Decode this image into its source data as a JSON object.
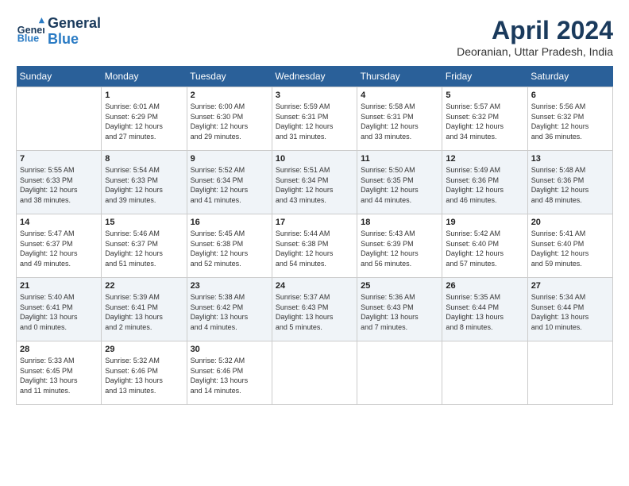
{
  "header": {
    "logo_line1": "General",
    "logo_line2": "Blue",
    "month": "April 2024",
    "location": "Deoranian, Uttar Pradesh, India"
  },
  "weekdays": [
    "Sunday",
    "Monday",
    "Tuesday",
    "Wednesday",
    "Thursday",
    "Friday",
    "Saturday"
  ],
  "weeks": [
    [
      {
        "day": "",
        "info": ""
      },
      {
        "day": "1",
        "info": "Sunrise: 6:01 AM\nSunset: 6:29 PM\nDaylight: 12 hours\nand 27 minutes."
      },
      {
        "day": "2",
        "info": "Sunrise: 6:00 AM\nSunset: 6:30 PM\nDaylight: 12 hours\nand 29 minutes."
      },
      {
        "day": "3",
        "info": "Sunrise: 5:59 AM\nSunset: 6:31 PM\nDaylight: 12 hours\nand 31 minutes."
      },
      {
        "day": "4",
        "info": "Sunrise: 5:58 AM\nSunset: 6:31 PM\nDaylight: 12 hours\nand 33 minutes."
      },
      {
        "day": "5",
        "info": "Sunrise: 5:57 AM\nSunset: 6:32 PM\nDaylight: 12 hours\nand 34 minutes."
      },
      {
        "day": "6",
        "info": "Sunrise: 5:56 AM\nSunset: 6:32 PM\nDaylight: 12 hours\nand 36 minutes."
      }
    ],
    [
      {
        "day": "7",
        "info": "Sunrise: 5:55 AM\nSunset: 6:33 PM\nDaylight: 12 hours\nand 38 minutes."
      },
      {
        "day": "8",
        "info": "Sunrise: 5:54 AM\nSunset: 6:33 PM\nDaylight: 12 hours\nand 39 minutes."
      },
      {
        "day": "9",
        "info": "Sunrise: 5:52 AM\nSunset: 6:34 PM\nDaylight: 12 hours\nand 41 minutes."
      },
      {
        "day": "10",
        "info": "Sunrise: 5:51 AM\nSunset: 6:34 PM\nDaylight: 12 hours\nand 43 minutes."
      },
      {
        "day": "11",
        "info": "Sunrise: 5:50 AM\nSunset: 6:35 PM\nDaylight: 12 hours\nand 44 minutes."
      },
      {
        "day": "12",
        "info": "Sunrise: 5:49 AM\nSunset: 6:36 PM\nDaylight: 12 hours\nand 46 minutes."
      },
      {
        "day": "13",
        "info": "Sunrise: 5:48 AM\nSunset: 6:36 PM\nDaylight: 12 hours\nand 48 minutes."
      }
    ],
    [
      {
        "day": "14",
        "info": "Sunrise: 5:47 AM\nSunset: 6:37 PM\nDaylight: 12 hours\nand 49 minutes."
      },
      {
        "day": "15",
        "info": "Sunrise: 5:46 AM\nSunset: 6:37 PM\nDaylight: 12 hours\nand 51 minutes."
      },
      {
        "day": "16",
        "info": "Sunrise: 5:45 AM\nSunset: 6:38 PM\nDaylight: 12 hours\nand 52 minutes."
      },
      {
        "day": "17",
        "info": "Sunrise: 5:44 AM\nSunset: 6:38 PM\nDaylight: 12 hours\nand 54 minutes."
      },
      {
        "day": "18",
        "info": "Sunrise: 5:43 AM\nSunset: 6:39 PM\nDaylight: 12 hours\nand 56 minutes."
      },
      {
        "day": "19",
        "info": "Sunrise: 5:42 AM\nSunset: 6:40 PM\nDaylight: 12 hours\nand 57 minutes."
      },
      {
        "day": "20",
        "info": "Sunrise: 5:41 AM\nSunset: 6:40 PM\nDaylight: 12 hours\nand 59 minutes."
      }
    ],
    [
      {
        "day": "21",
        "info": "Sunrise: 5:40 AM\nSunset: 6:41 PM\nDaylight: 13 hours\nand 0 minutes."
      },
      {
        "day": "22",
        "info": "Sunrise: 5:39 AM\nSunset: 6:41 PM\nDaylight: 13 hours\nand 2 minutes."
      },
      {
        "day": "23",
        "info": "Sunrise: 5:38 AM\nSunset: 6:42 PM\nDaylight: 13 hours\nand 4 minutes."
      },
      {
        "day": "24",
        "info": "Sunrise: 5:37 AM\nSunset: 6:43 PM\nDaylight: 13 hours\nand 5 minutes."
      },
      {
        "day": "25",
        "info": "Sunrise: 5:36 AM\nSunset: 6:43 PM\nDaylight: 13 hours\nand 7 minutes."
      },
      {
        "day": "26",
        "info": "Sunrise: 5:35 AM\nSunset: 6:44 PM\nDaylight: 13 hours\nand 8 minutes."
      },
      {
        "day": "27",
        "info": "Sunrise: 5:34 AM\nSunset: 6:44 PM\nDaylight: 13 hours\nand 10 minutes."
      }
    ],
    [
      {
        "day": "28",
        "info": "Sunrise: 5:33 AM\nSunset: 6:45 PM\nDaylight: 13 hours\nand 11 minutes."
      },
      {
        "day": "29",
        "info": "Sunrise: 5:32 AM\nSunset: 6:46 PM\nDaylight: 13 hours\nand 13 minutes."
      },
      {
        "day": "30",
        "info": "Sunrise: 5:32 AM\nSunset: 6:46 PM\nDaylight: 13 hours\nand 14 minutes."
      },
      {
        "day": "",
        "info": ""
      },
      {
        "day": "",
        "info": ""
      },
      {
        "day": "",
        "info": ""
      },
      {
        "day": "",
        "info": ""
      }
    ]
  ]
}
